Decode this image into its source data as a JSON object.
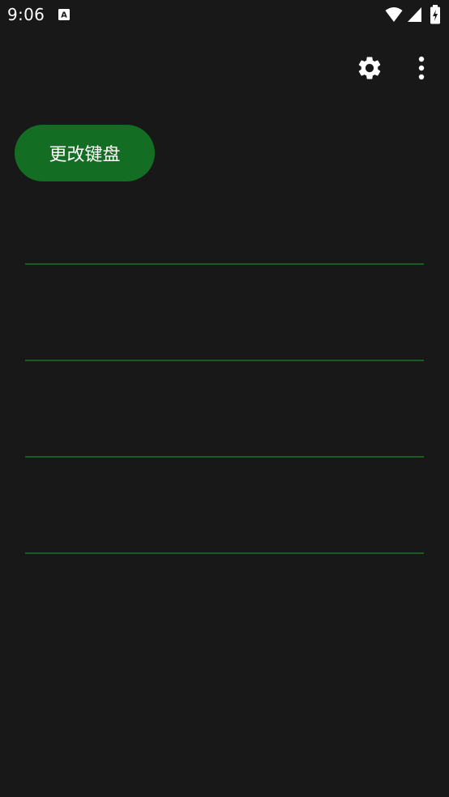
{
  "status_bar": {
    "time": "9:06",
    "notification_icon": "keyboard-a-icon",
    "wifi_icon": "wifi-icon",
    "signal_icon": "cell-signal-icon",
    "battery_icon": "battery-charging-icon"
  },
  "toolbar": {
    "settings_icon": "gear-icon",
    "more_icon": "more-vert-icon"
  },
  "main": {
    "change_keyboard_label": "更改键盘",
    "inputs": [
      {
        "value": "",
        "placeholder": ""
      },
      {
        "value": "",
        "placeholder": ""
      },
      {
        "value": "",
        "placeholder": ""
      },
      {
        "value": "",
        "placeholder": ""
      }
    ]
  },
  "colors": {
    "background": "#181818",
    "accent": "#136e23",
    "underline": "#1a5c25"
  }
}
